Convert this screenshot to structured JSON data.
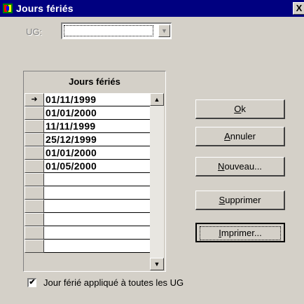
{
  "window": {
    "title": "Jours fériés",
    "close_label": "X"
  },
  "ug": {
    "label": "UG:",
    "value": ""
  },
  "grid": {
    "header": "Jours fériés",
    "current_row_marker": "➜",
    "rows": [
      "01/11/1999",
      "01/01/2000",
      "11/11/1999",
      "25/12/1999",
      "01/01/2000",
      "01/05/2000",
      "",
      "",
      "",
      "",
      "",
      ""
    ],
    "scroll_up": "▲",
    "scroll_down": "▼"
  },
  "buttons": {
    "ok": {
      "underlined": "O",
      "rest": "k"
    },
    "annuler": {
      "underlined": "A",
      "rest": "nnuler"
    },
    "nouveau": {
      "underlined": "N",
      "rest": "ouveau..."
    },
    "supprimer": {
      "underlined": "S",
      "rest": "upprimer"
    },
    "imprimer": {
      "underlined": "I",
      "rest": "mprimer..."
    }
  },
  "checkbox": {
    "checked": true,
    "mark": "✔",
    "label": "Jour férié appliqué à toutes les UG"
  },
  "colors": {
    "titlebar": "#000080",
    "face": "#d4d0c8"
  },
  "icons": {
    "app": "app-icon",
    "close": "close-icon",
    "dropdown": "chevron-down-icon",
    "row-pointer": "row-pointer-icon"
  }
}
